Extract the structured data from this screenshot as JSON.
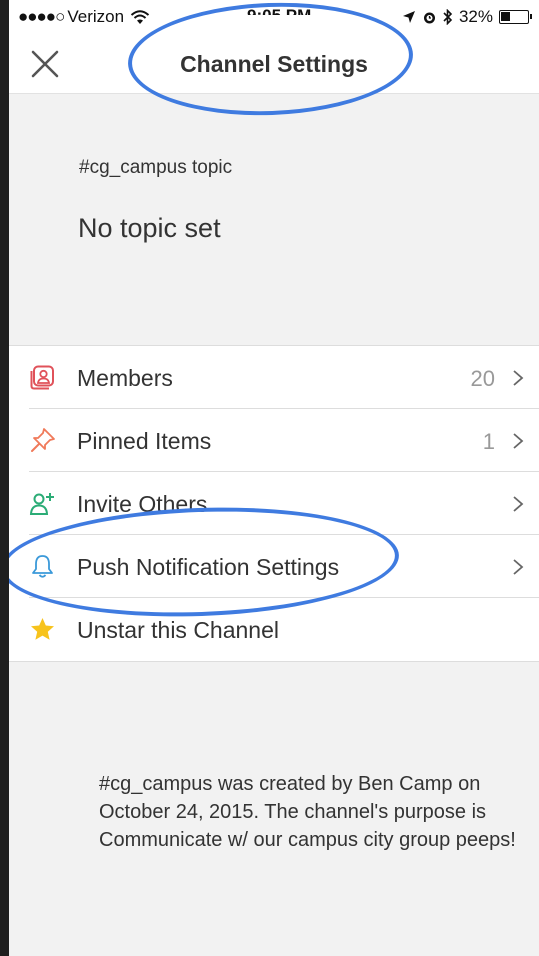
{
  "status_bar": {
    "signal": "●●●●○",
    "carrier": "Verizon",
    "time": "9:05 PM",
    "battery": "32%"
  },
  "nav": {
    "title": "Channel Settings",
    "close_icon": "close-icon"
  },
  "topic": {
    "label": "#cg_campus topic",
    "value": "No topic set"
  },
  "settings": [
    {
      "label": "Members",
      "count": "20",
      "icon": "members-icon",
      "color": "#e0525a"
    },
    {
      "label": "Pinned Items",
      "count": "1",
      "icon": "pin-icon",
      "color": "#f07a5a"
    },
    {
      "label": "Invite Others",
      "count": "",
      "icon": "add-person-icon",
      "color": "#2bac76"
    },
    {
      "label": "Push Notification Settings",
      "count": "",
      "icon": "bell-icon",
      "color": "#3b99d9"
    },
    {
      "label": "Unstar this Channel",
      "count": "",
      "icon": "star-icon",
      "color": "#f7c31c"
    }
  ],
  "purpose": {
    "text": "#cg_campus was created by Ben Camp on October 24, 2015. The channel's purpose is Communicate w/ our campus city group peeps!"
  },
  "annotation_color": "#3f7be0"
}
